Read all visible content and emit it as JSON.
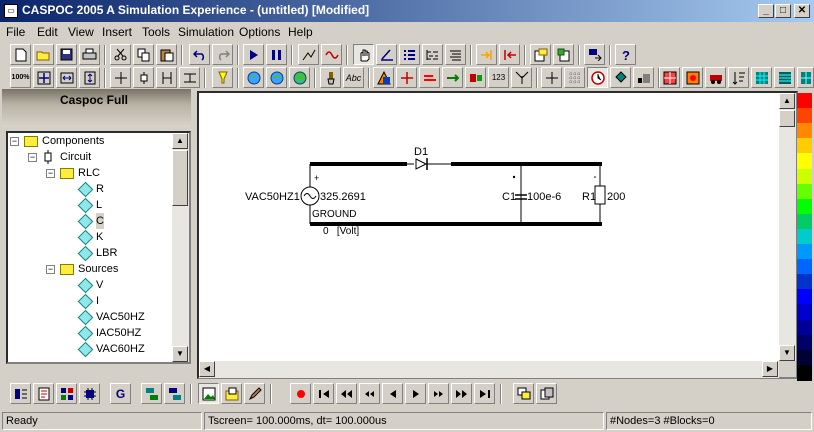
{
  "window": {
    "title": "CASPOC 2005 A Simulation Experience - (untitled) [Modified]",
    "app_icon": "caspoc-app-icon",
    "controls": [
      "_",
      "□",
      "✕"
    ]
  },
  "menu": [
    "File",
    "Edit",
    "View",
    "Insert",
    "Tools",
    "Simulation",
    "Options",
    "Help"
  ],
  "sidebar": {
    "banner_title": "Caspoc Full",
    "tree": [
      {
        "label": "Components",
        "level": 0,
        "type": "folder",
        "expanded": true
      },
      {
        "label": "Circuit",
        "level": 1,
        "type": "circuit",
        "expanded": true
      },
      {
        "label": "RLC",
        "level": 2,
        "type": "folder",
        "expanded": true
      },
      {
        "label": "R",
        "level": 3,
        "type": "component"
      },
      {
        "label": "L",
        "level": 3,
        "type": "component"
      },
      {
        "label": "C",
        "level": 3,
        "type": "component",
        "selected": true
      },
      {
        "label": "K",
        "level": 3,
        "type": "component"
      },
      {
        "label": "LBR",
        "level": 3,
        "type": "component"
      },
      {
        "label": "Sources",
        "level": 2,
        "type": "folder",
        "expanded": true
      },
      {
        "label": "V",
        "level": 3,
        "type": "component"
      },
      {
        "label": "I",
        "level": 3,
        "type": "component"
      },
      {
        "label": "VAC50HZ",
        "level": 3,
        "type": "component"
      },
      {
        "label": "IAC50HZ",
        "level": 3,
        "type": "component"
      },
      {
        "label": "VAC60HZ",
        "level": 3,
        "type": "component"
      }
    ]
  },
  "schematic": {
    "source_name": "VAC50HZ1",
    "source_value": "325.2691",
    "source_plus": "+",
    "ground_label": "GROUND",
    "ground_readout": "0   [Volt]",
    "diode_name": "D1",
    "cap_name": "C1",
    "cap_value": "100e-6",
    "res_name": "R1",
    "res_value": "200"
  },
  "status": {
    "ready": "Ready",
    "timing": "Tscreen= 100.000ms, dt= 100.000us",
    "counts": "#Nodes=3 #Blocks=0"
  },
  "colors": {
    "titlebar_start": "#0a246a",
    "titlebar_end": "#a6caf0",
    "palette": [
      "#ff0000",
      "#ff4400",
      "#ff8800",
      "#ffcc00",
      "#ffff00",
      "#ccff00",
      "#66ff00",
      "#00ff00",
      "#00cc66",
      "#00cccc",
      "#0099ff",
      "#0066ff",
      "#0033cc",
      "#0000ff",
      "#0000cc",
      "#000099",
      "#000066",
      "#000033",
      "#000000"
    ]
  }
}
